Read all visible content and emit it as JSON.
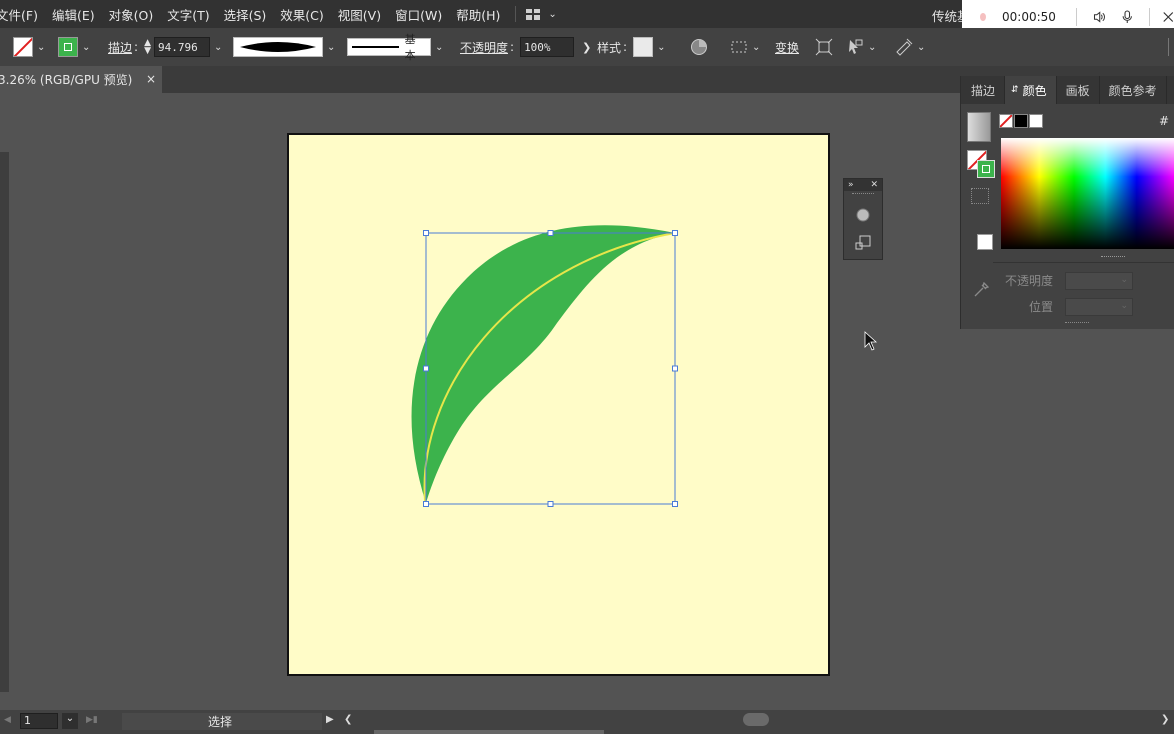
{
  "menu": {
    "items": [
      "文件(F)",
      "编辑(E)",
      "对象(O)",
      "文字(T)",
      "选择(S)",
      "效果(C)",
      "视图(V)",
      "窗口(W)",
      "帮助(H)"
    ],
    "workspace_label": "传统基"
  },
  "control": {
    "stroke_label": "描边",
    "stroke_value": "94.796",
    "profile_label": "基本",
    "opacity_label": "不透明度",
    "opacity_value": "100%",
    "style_label": "样式",
    "transform_label": "变换"
  },
  "tab": {
    "title": "3.26% (RGB/GPU 预览)",
    "close": "×"
  },
  "color_panel": {
    "tabs": [
      "描边",
      "颜色",
      "画板",
      "颜色参考"
    ],
    "active_tab": "颜色",
    "hex_label": "#",
    "opacity_label": "不透明度",
    "position_label": "位置"
  },
  "recorder": {
    "time": "00:00:50"
  },
  "status": {
    "page_value": "1",
    "tool_name": "选择"
  },
  "colors": {
    "leaf": "#3cb34c",
    "artboard": "#fffcc8",
    "selection": "#4a7bd6",
    "vein": "#e6e64a"
  }
}
